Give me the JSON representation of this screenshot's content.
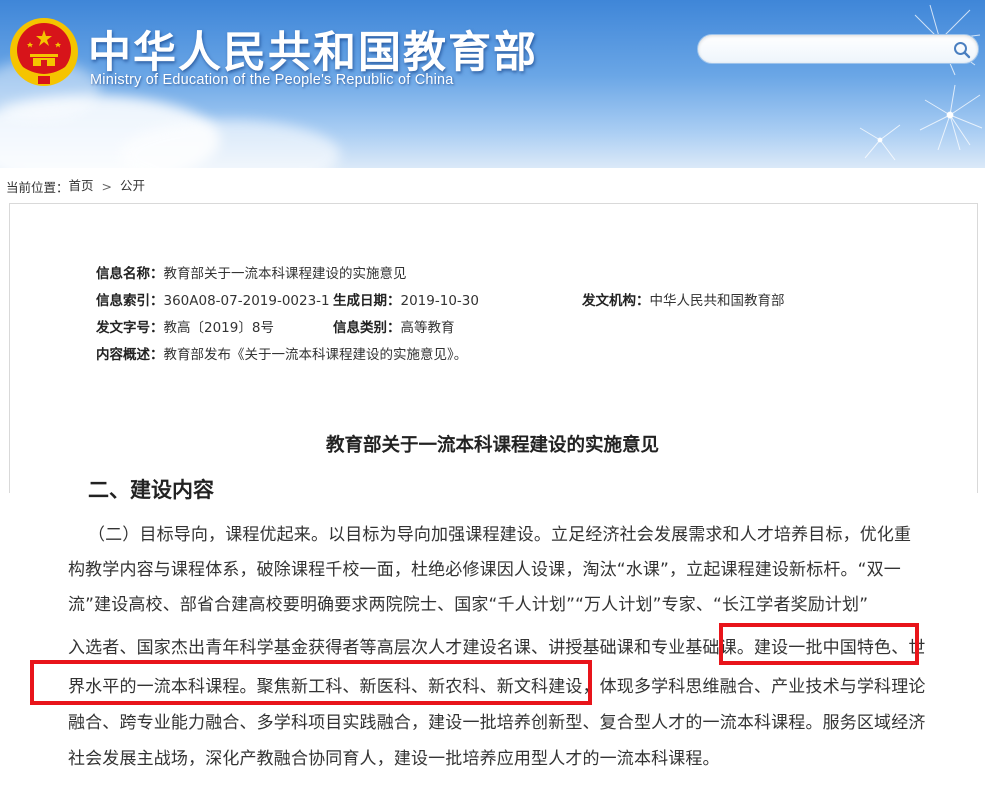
{
  "header": {
    "site_title": "中华人民共和国教育部",
    "site_subtitle": "Ministry of Education of the People's Republic of China",
    "emblem_icon": "national-emblem-icon",
    "search": {
      "value": "",
      "placeholder": "",
      "icon": "search-icon"
    }
  },
  "breadcrumb": {
    "prefix": "当前位置：",
    "items": [
      "首页",
      "公开"
    ],
    "separator": ">"
  },
  "meta": {
    "name_label": "信息名称：",
    "name_value": "教育部关于一流本科课程建设的实施意见",
    "index_label": "信息索引：",
    "index_value": "360A08-07-2019-0023-1",
    "date_label": "生成日期：",
    "date_value": "2019-10-30",
    "issuer_label": "发文机构：",
    "issuer_value": "中华人民共和国教育部",
    "docno_label": "发文字号：",
    "docno_value": "教高〔2019〕8号",
    "category_label": "信息类别：",
    "category_value": "高等教育",
    "summary_label": "内容概述：",
    "summary_value": "教育部发布《关于一流本科课程建设的实施意见》。"
  },
  "document": {
    "title": "教育部关于一流本科课程建设的实施意见",
    "section_heading": "二、建设内容",
    "body_lines": [
      "（二）目标导向，课程优起来。以目标为导向加强课程建设。立足经济社会发展需求和人才培养目标，优化重",
      "构教学内容与课程体系，破除课程千校一面，杜绝必修课因人设课，淘汰“水课”，立起课程建设新标杆。“双一",
      "流”建设高校、部省合建高校要明确要求两院院士、国家“千人计划”“万人计划”专家、“长江学者奖励计划”",
      "入选者、国家杰出青年科学基金获得者等高层次人才建设名课、讲授基础课和专业基础课。建设一批中国特色、世",
      "界水平的一流本科课程。聚焦新工科、新医科、新农科、新文科建设，体现多学科思维融合、产业技术与学科理论",
      "融合、跨专业能力融合、多学科项目实践融合，建设一批培养创新型、复合型人才的一流本科课程。服务区域经济",
      "社会发展主战场，深化产教融合协同育人，建设一批培养应用型人才的一流本科课程。"
    ]
  },
  "colors": {
    "banner_top": "#3f86d8",
    "banner_bottom": "#dbe9f8",
    "highlight": "#e8141a",
    "emblem_red": "#d7141a",
    "emblem_gold": "#f5c400"
  }
}
